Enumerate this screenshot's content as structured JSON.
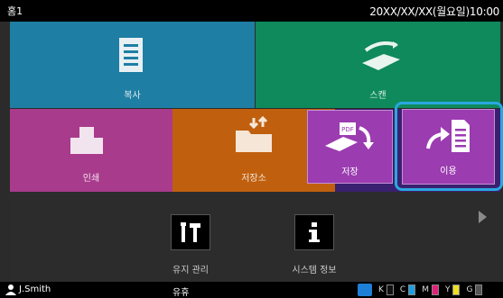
{
  "header": {
    "title": "홈1",
    "datetime": "20XX/XX/XX(월요일)10:00"
  },
  "tiles": {
    "copy": {
      "label": "복사",
      "color": "#1f7ea3"
    },
    "scan": {
      "label": "스캔",
      "color": "#0e8a5c"
    },
    "print": {
      "label": "인쇄",
      "color": "#a93b8c"
    },
    "storage": {
      "label": "저장소",
      "color": "#c0600e"
    }
  },
  "popup": {
    "save": {
      "label": "저장",
      "badge": "PDF"
    },
    "use": {
      "label": "이용"
    }
  },
  "bottom": {
    "maintenance_label": "유지 관리",
    "system_info_label": "시스템 정보"
  },
  "status_bar": {
    "user": "J.Smith",
    "state": "유휴",
    "ink": [
      {
        "letter": "K",
        "color": "#111111"
      },
      {
        "letter": "C",
        "color": "#1ea0e0"
      },
      {
        "letter": "M",
        "color": "#e0207a"
      },
      {
        "letter": "Y",
        "color": "#f0e020"
      },
      {
        "letter": "G",
        "color": "#555555"
      }
    ]
  },
  "icons": [
    "copy-icon",
    "scan-icon",
    "print-icon",
    "storage-icon",
    "pdf-save-icon",
    "use-icon",
    "maintenance-icon",
    "info-icon",
    "next-icon",
    "user-icon",
    "network-icon"
  ],
  "accent_color": "#2aa7e0"
}
